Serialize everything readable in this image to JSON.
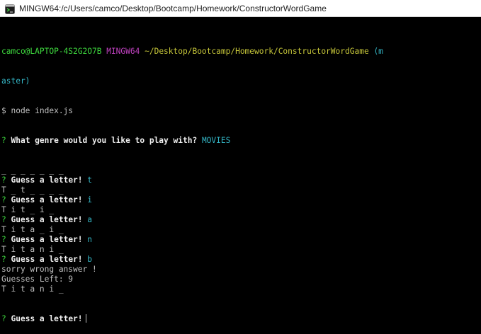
{
  "window": {
    "title": "MINGW64:/c/Users/camco/Desktop/Bootcamp/Homework/ConstructorWordGame",
    "icon": "git-bash-icon"
  },
  "prompt": {
    "user_host": "camco@LAPTOP-4S2G2O7B",
    "shell": "MINGW64",
    "path": "~/Desktop/Bootcamp/Homework/ConstructorWordGame",
    "branch_line1": "(m",
    "branch_line2": "aster)",
    "command": "$ node index.js"
  },
  "session": {
    "genre_q": "What genre would you like to play with?",
    "genre_a": "MOVIES",
    "lines": [
      {
        "kind": "text",
        "text": "_ _ _ _ _ _ _"
      },
      {
        "kind": "guess",
        "q": "Guess a letter!",
        "a": "t"
      },
      {
        "kind": "text",
        "text": "T _ t _ _ _ _"
      },
      {
        "kind": "guess",
        "q": "Guess a letter!",
        "a": "i"
      },
      {
        "kind": "text",
        "text": "T i t _ i _"
      },
      {
        "kind": "guess",
        "q": "Guess a letter!",
        "a": "a"
      },
      {
        "kind": "text",
        "text": "T i t a _ i _"
      },
      {
        "kind": "guess",
        "q": "Guess a letter!",
        "a": "n"
      },
      {
        "kind": "text",
        "text": "T i t a n i _"
      },
      {
        "kind": "guess",
        "q": "Guess a letter!",
        "a": "b"
      },
      {
        "kind": "text",
        "text": "sorry wrong answer !"
      },
      {
        "kind": "text",
        "text": "Guesses Left: 9"
      },
      {
        "kind": "text",
        "text": "T i t a n i _"
      }
    ],
    "final_q": "Guess a letter!",
    "question_mark": "?"
  },
  "colors": {
    "background": "#000000",
    "text": "#c0c0c0",
    "user": "#3fdc3f",
    "shell": "#c042c0",
    "path": "#c8c83a",
    "branch": "#35b8c8",
    "answer": "#35b8c8"
  }
}
